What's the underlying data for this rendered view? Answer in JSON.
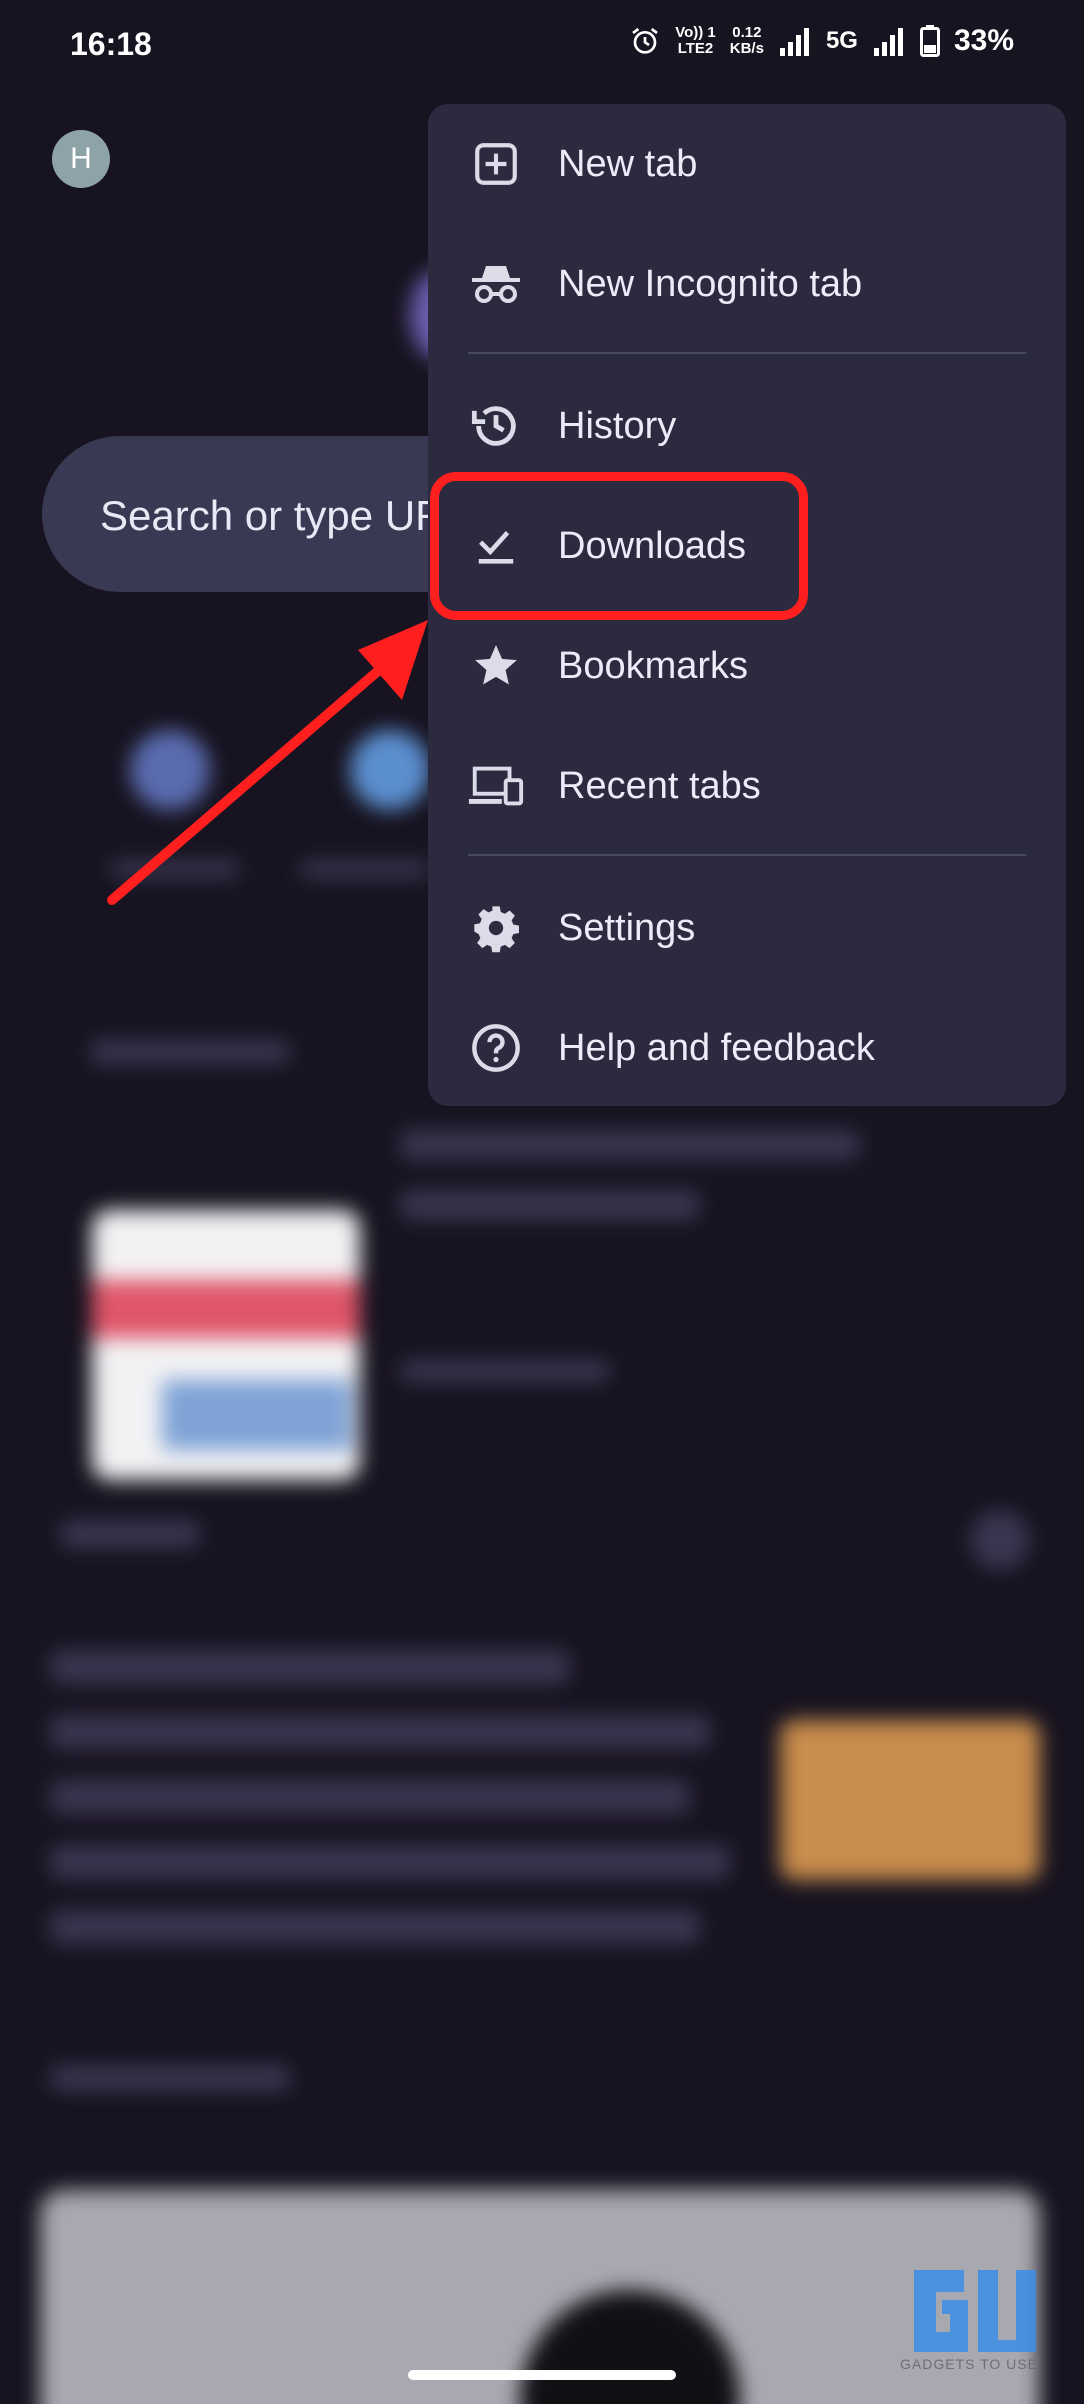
{
  "status_bar": {
    "time": "16:18",
    "volte_top": "Vo)) 1",
    "volte_bottom": "LTE2",
    "speed_value": "0.12",
    "speed_unit": "KB/s",
    "network": "5G",
    "battery": "33%"
  },
  "background": {
    "avatar_initial": "H",
    "search_placeholder": "Search or type URL"
  },
  "menu": {
    "items": [
      {
        "label": "New tab",
        "icon": "plus-box-icon"
      },
      {
        "label": "New Incognito tab",
        "icon": "incognito-icon"
      },
      {
        "label": "History",
        "icon": "history-icon"
      },
      {
        "label": "Downloads",
        "icon": "download-check-icon"
      },
      {
        "label": "Bookmarks",
        "icon": "star-icon"
      },
      {
        "label": "Recent tabs",
        "icon": "devices-icon"
      },
      {
        "label": "Settings",
        "icon": "gear-icon"
      },
      {
        "label": "Help and feedback",
        "icon": "help-circle-icon"
      }
    ]
  },
  "annotation": {
    "highlight_color": "#ff1f1f",
    "arrow_color": "#ff1f1f"
  },
  "watermark": {
    "text": "GADGETS TO USE"
  },
  "colors": {
    "background": "#171320",
    "menu_bg": "#2b2a3f",
    "menu_text": "#ecebf7"
  }
}
